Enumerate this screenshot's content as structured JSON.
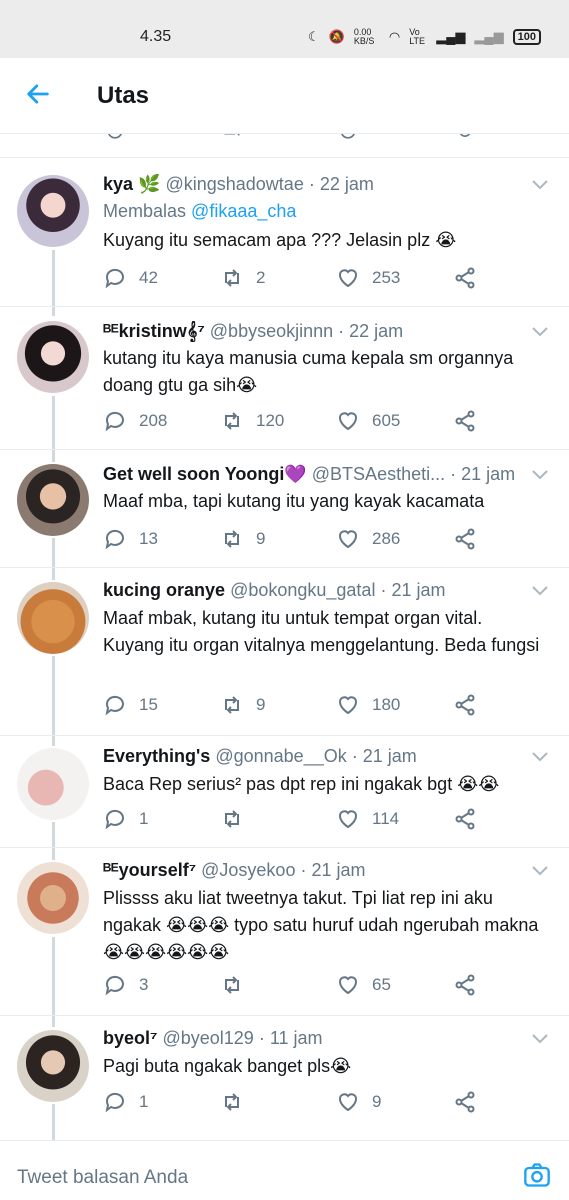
{
  "status_bar": {
    "time": "4.35",
    "speed": "0.00 KB/S",
    "network": "Vo LTE",
    "battery": "100"
  },
  "header": {
    "title": "Utas"
  },
  "composer": {
    "placeholder": "Tweet balasan Anda"
  },
  "tweets": [
    {
      "name": "kya 🌿",
      "handle": "@kingshadowtae",
      "time": "· 22 jam",
      "reply_label": "Membalas",
      "reply_to": "@fikaaa_cha",
      "text": "Kuyang itu semacam apa ??? Jelasin plz 😭",
      "replies": "42",
      "retweets": "2",
      "likes": "253"
    },
    {
      "name": "ᴮᴱkristinw𝄞⁷",
      "handle": "@bbyseokjinnn",
      "time": "· 22 jam",
      "text": "kutang itu kaya manusia cuma kepala sm organnya doang gtu ga sih😭",
      "replies": "208",
      "retweets": "120",
      "likes": "605"
    },
    {
      "name": "Get well soon Yoongi💜",
      "handle": "@BTSAestheti...",
      "time": "· 21 jam",
      "text": "Maaf mba, tapi kutang itu yang kayak kacamata",
      "replies": "13",
      "retweets": "9",
      "likes": "286"
    },
    {
      "name": "kucing oranye",
      "handle": "@bokongku_gatal",
      "time": "· 21 jam",
      "text": "Maaf mbak, kutang itu untuk tempat organ vital. Kuyang itu organ vitalnya menggelantung. Beda fungsi",
      "replies": "15",
      "retweets": "9",
      "likes": "180"
    },
    {
      "name": "Everything's",
      "handle": "@gonnabe__Ok",
      "time": "· 21 jam",
      "text": "Baca Rep serius² pas dpt rep ini ngakak bgt 😭😭",
      "replies": "1",
      "retweets": "",
      "likes": "114"
    },
    {
      "name": "ᴮᴱyourself⁷",
      "handle": "@Josyekoo",
      "time": "· 21 jam",
      "text": "Plissss aku liat tweetnya takut. Tpi liat rep ini aku ngakak 😭😭😭 typo satu huruf udah ngerubah makna 😭😭😭😭😭😭",
      "replies": "3",
      "retweets": "",
      "likes": "65"
    },
    {
      "name": "byeol⁷",
      "handle": "@byeol129",
      "time": "· 11 jam",
      "text": "Pagi buta ngakak banget pls😭",
      "replies": "1",
      "retweets": "",
      "likes": "9"
    }
  ],
  "colors": {
    "accent": "#1da1f2",
    "muted": "#657786",
    "text": "#14171a",
    "thread": "#cfd9de"
  }
}
